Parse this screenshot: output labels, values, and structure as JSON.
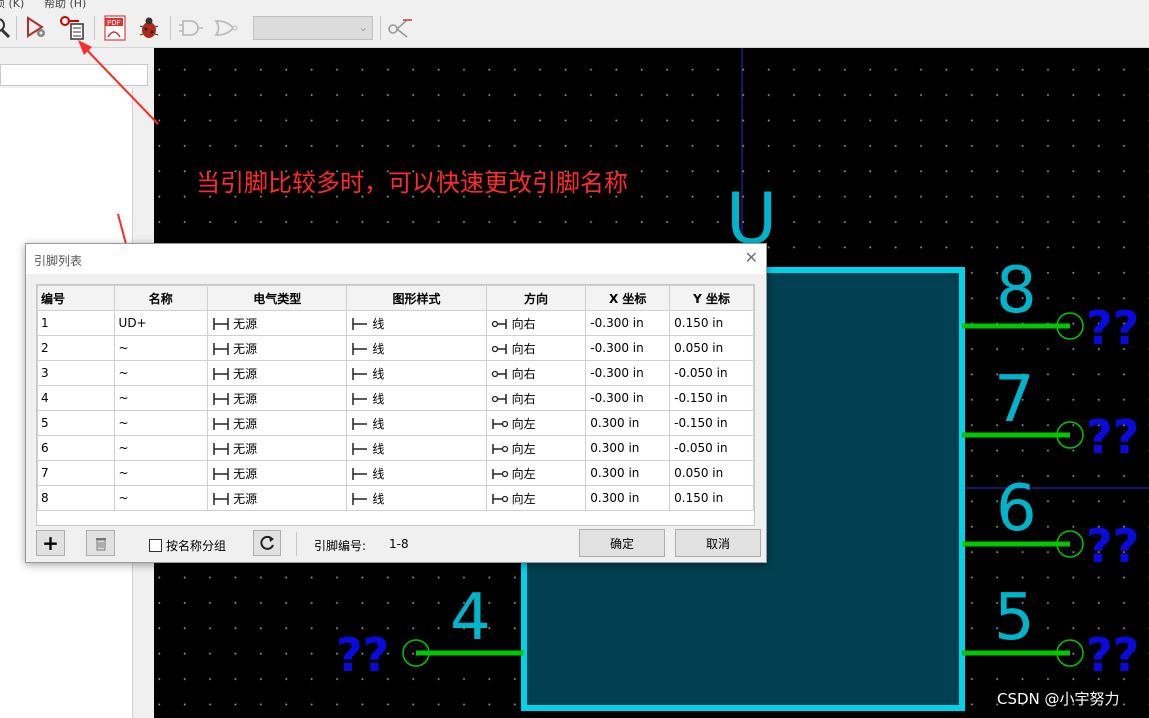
{
  "menu": {
    "item_a": "项 (K)",
    "item_b": "帮助 (H)"
  },
  "toolbar": {
    "icons": [
      "inspect-icon",
      "pin-table-icon",
      "pdf-export-icon",
      "debug-bug-icon",
      "gate-icon",
      "alt-gate-icon",
      "combo",
      "netlist-icon"
    ],
    "pdf_text": "PDF",
    "combo_value": ""
  },
  "annotation": {
    "text": "当引脚比较多时，可以快速更改引脚名称",
    "color": "#ff2a2a"
  },
  "watermark": "CSDN @小宇努力",
  "schematic": {
    "ref": "U",
    "pins_right": [
      {
        "num": "8",
        "name": "??"
      },
      {
        "num": "7",
        "name": "??"
      },
      {
        "num": "6",
        "name": "??"
      },
      {
        "num": "5",
        "name": "??"
      }
    ],
    "pins_left": [
      {
        "num": "4",
        "name": "??"
      }
    ],
    "colors": {
      "body_fill": "#004050",
      "body_stroke": "#00d2ea",
      "pin": "#00c800",
      "pin_num": "#00b4cc",
      "pin_name": "#0a0adc"
    }
  },
  "dialog": {
    "title": "引脚列表",
    "close": "✕",
    "columns": [
      "编号",
      "名称",
      "电气类型",
      "图形样式",
      "方向",
      "X 坐标",
      "Y 坐标"
    ],
    "rows": [
      {
        "num": "1",
        "name": "UD+",
        "etype": "无源",
        "style": "线",
        "dir": "向右",
        "x": "-0.300 in",
        "y": "0.150 in"
      },
      {
        "num": "2",
        "name": "~",
        "etype": "无源",
        "style": "线",
        "dir": "向右",
        "x": "-0.300 in",
        "y": "0.050 in"
      },
      {
        "num": "3",
        "name": "~",
        "etype": "无源",
        "style": "线",
        "dir": "向右",
        "x": "-0.300 in",
        "y": "-0.050 in"
      },
      {
        "num": "4",
        "name": "~",
        "etype": "无源",
        "style": "线",
        "dir": "向右",
        "x": "-0.300 in",
        "y": "-0.150 in"
      },
      {
        "num": "5",
        "name": "~",
        "etype": "无源",
        "style": "线",
        "dir": "向左",
        "x": "0.300 in",
        "y": "-0.150 in"
      },
      {
        "num": "6",
        "name": "~",
        "etype": "无源",
        "style": "线",
        "dir": "向左",
        "x": "0.300 in",
        "y": "-0.050 in"
      },
      {
        "num": "7",
        "name": "~",
        "etype": "无源",
        "style": "线",
        "dir": "向左",
        "x": "0.300 in",
        "y": "0.050 in"
      },
      {
        "num": "8",
        "name": "~",
        "etype": "无源",
        "style": "线",
        "dir": "向左",
        "x": "0.300 in",
        "y": "0.150 in"
      }
    ],
    "footer": {
      "add_label": "+",
      "group_by_name": "按名称分组",
      "pin_number_label": "引脚编号:",
      "pin_number_value": "1-8",
      "ok": "确定",
      "cancel": "取消"
    }
  }
}
